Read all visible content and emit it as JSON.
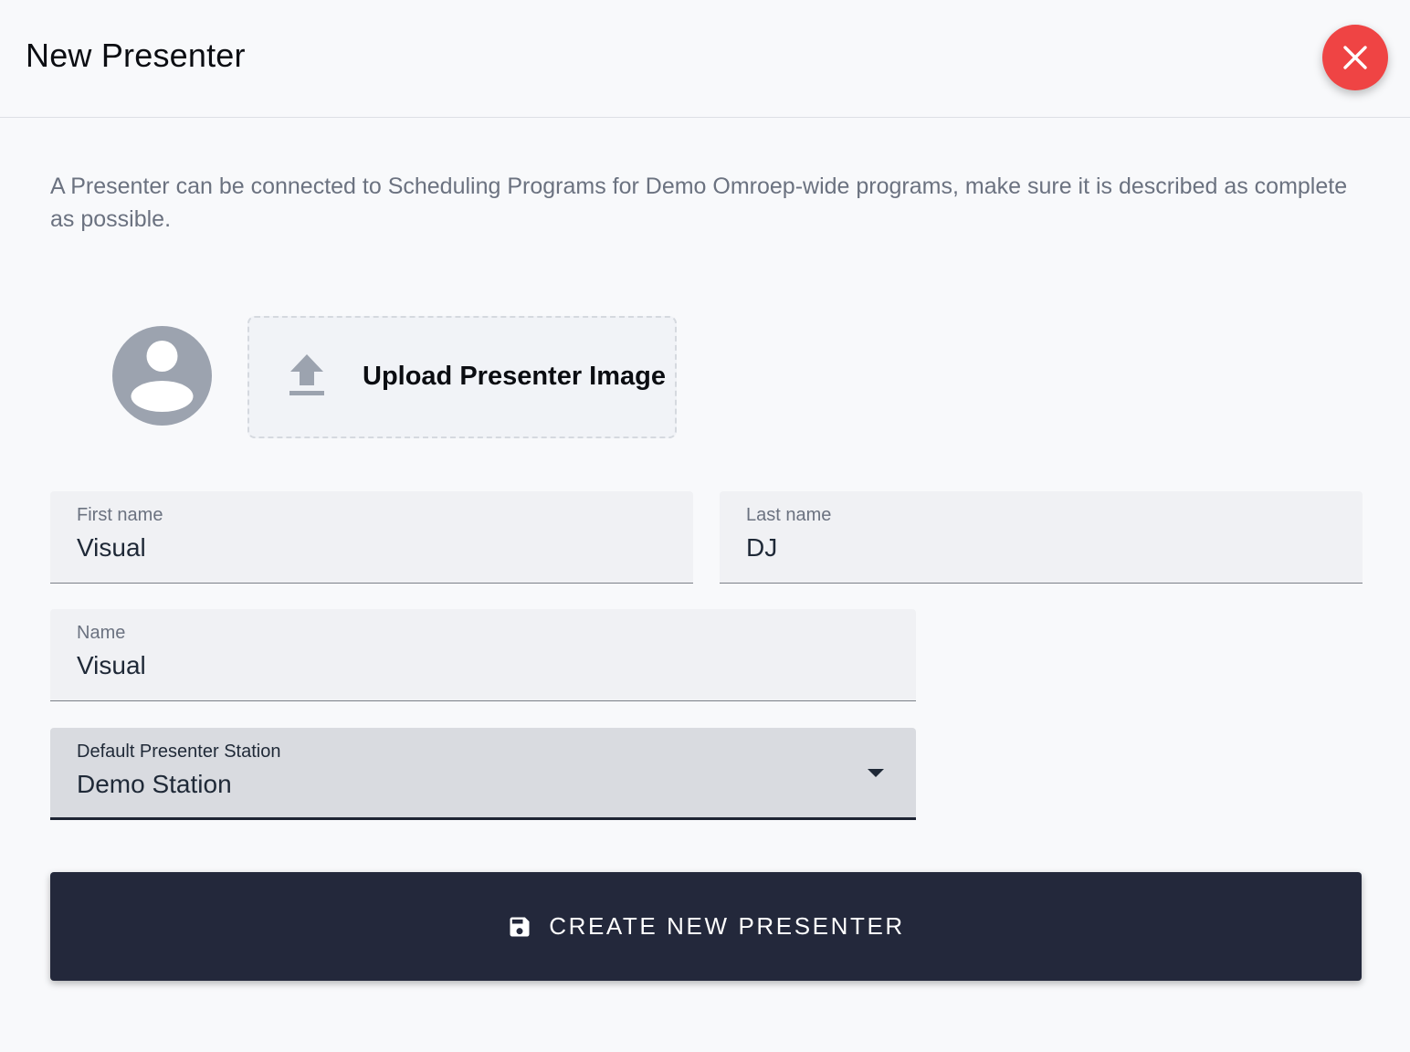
{
  "dialog": {
    "title": "New Presenter",
    "close_icon": "close-icon"
  },
  "description": "A Presenter can be connected to Scheduling Programs for Demo Omroep-wide programs, make sure it is described as complete as possible.",
  "image": {
    "avatar_icon": "person-avatar-icon",
    "upload_icon": "upload-icon",
    "upload_label": "Upload Presenter Image"
  },
  "form": {
    "first_name": {
      "label": "First name",
      "value": "Visual"
    },
    "last_name": {
      "label": "Last name",
      "value": "DJ"
    },
    "name": {
      "label": "Name",
      "value": "Visual"
    },
    "station": {
      "label": "Default Presenter Station",
      "value": "Demo Station"
    }
  },
  "submit": {
    "icon": "save-icon",
    "label": "CREATE NEW PRESENTER"
  },
  "colors": {
    "close_button": "#ef4444",
    "primary_button": "#23283b",
    "background": "#f8f9fb"
  }
}
